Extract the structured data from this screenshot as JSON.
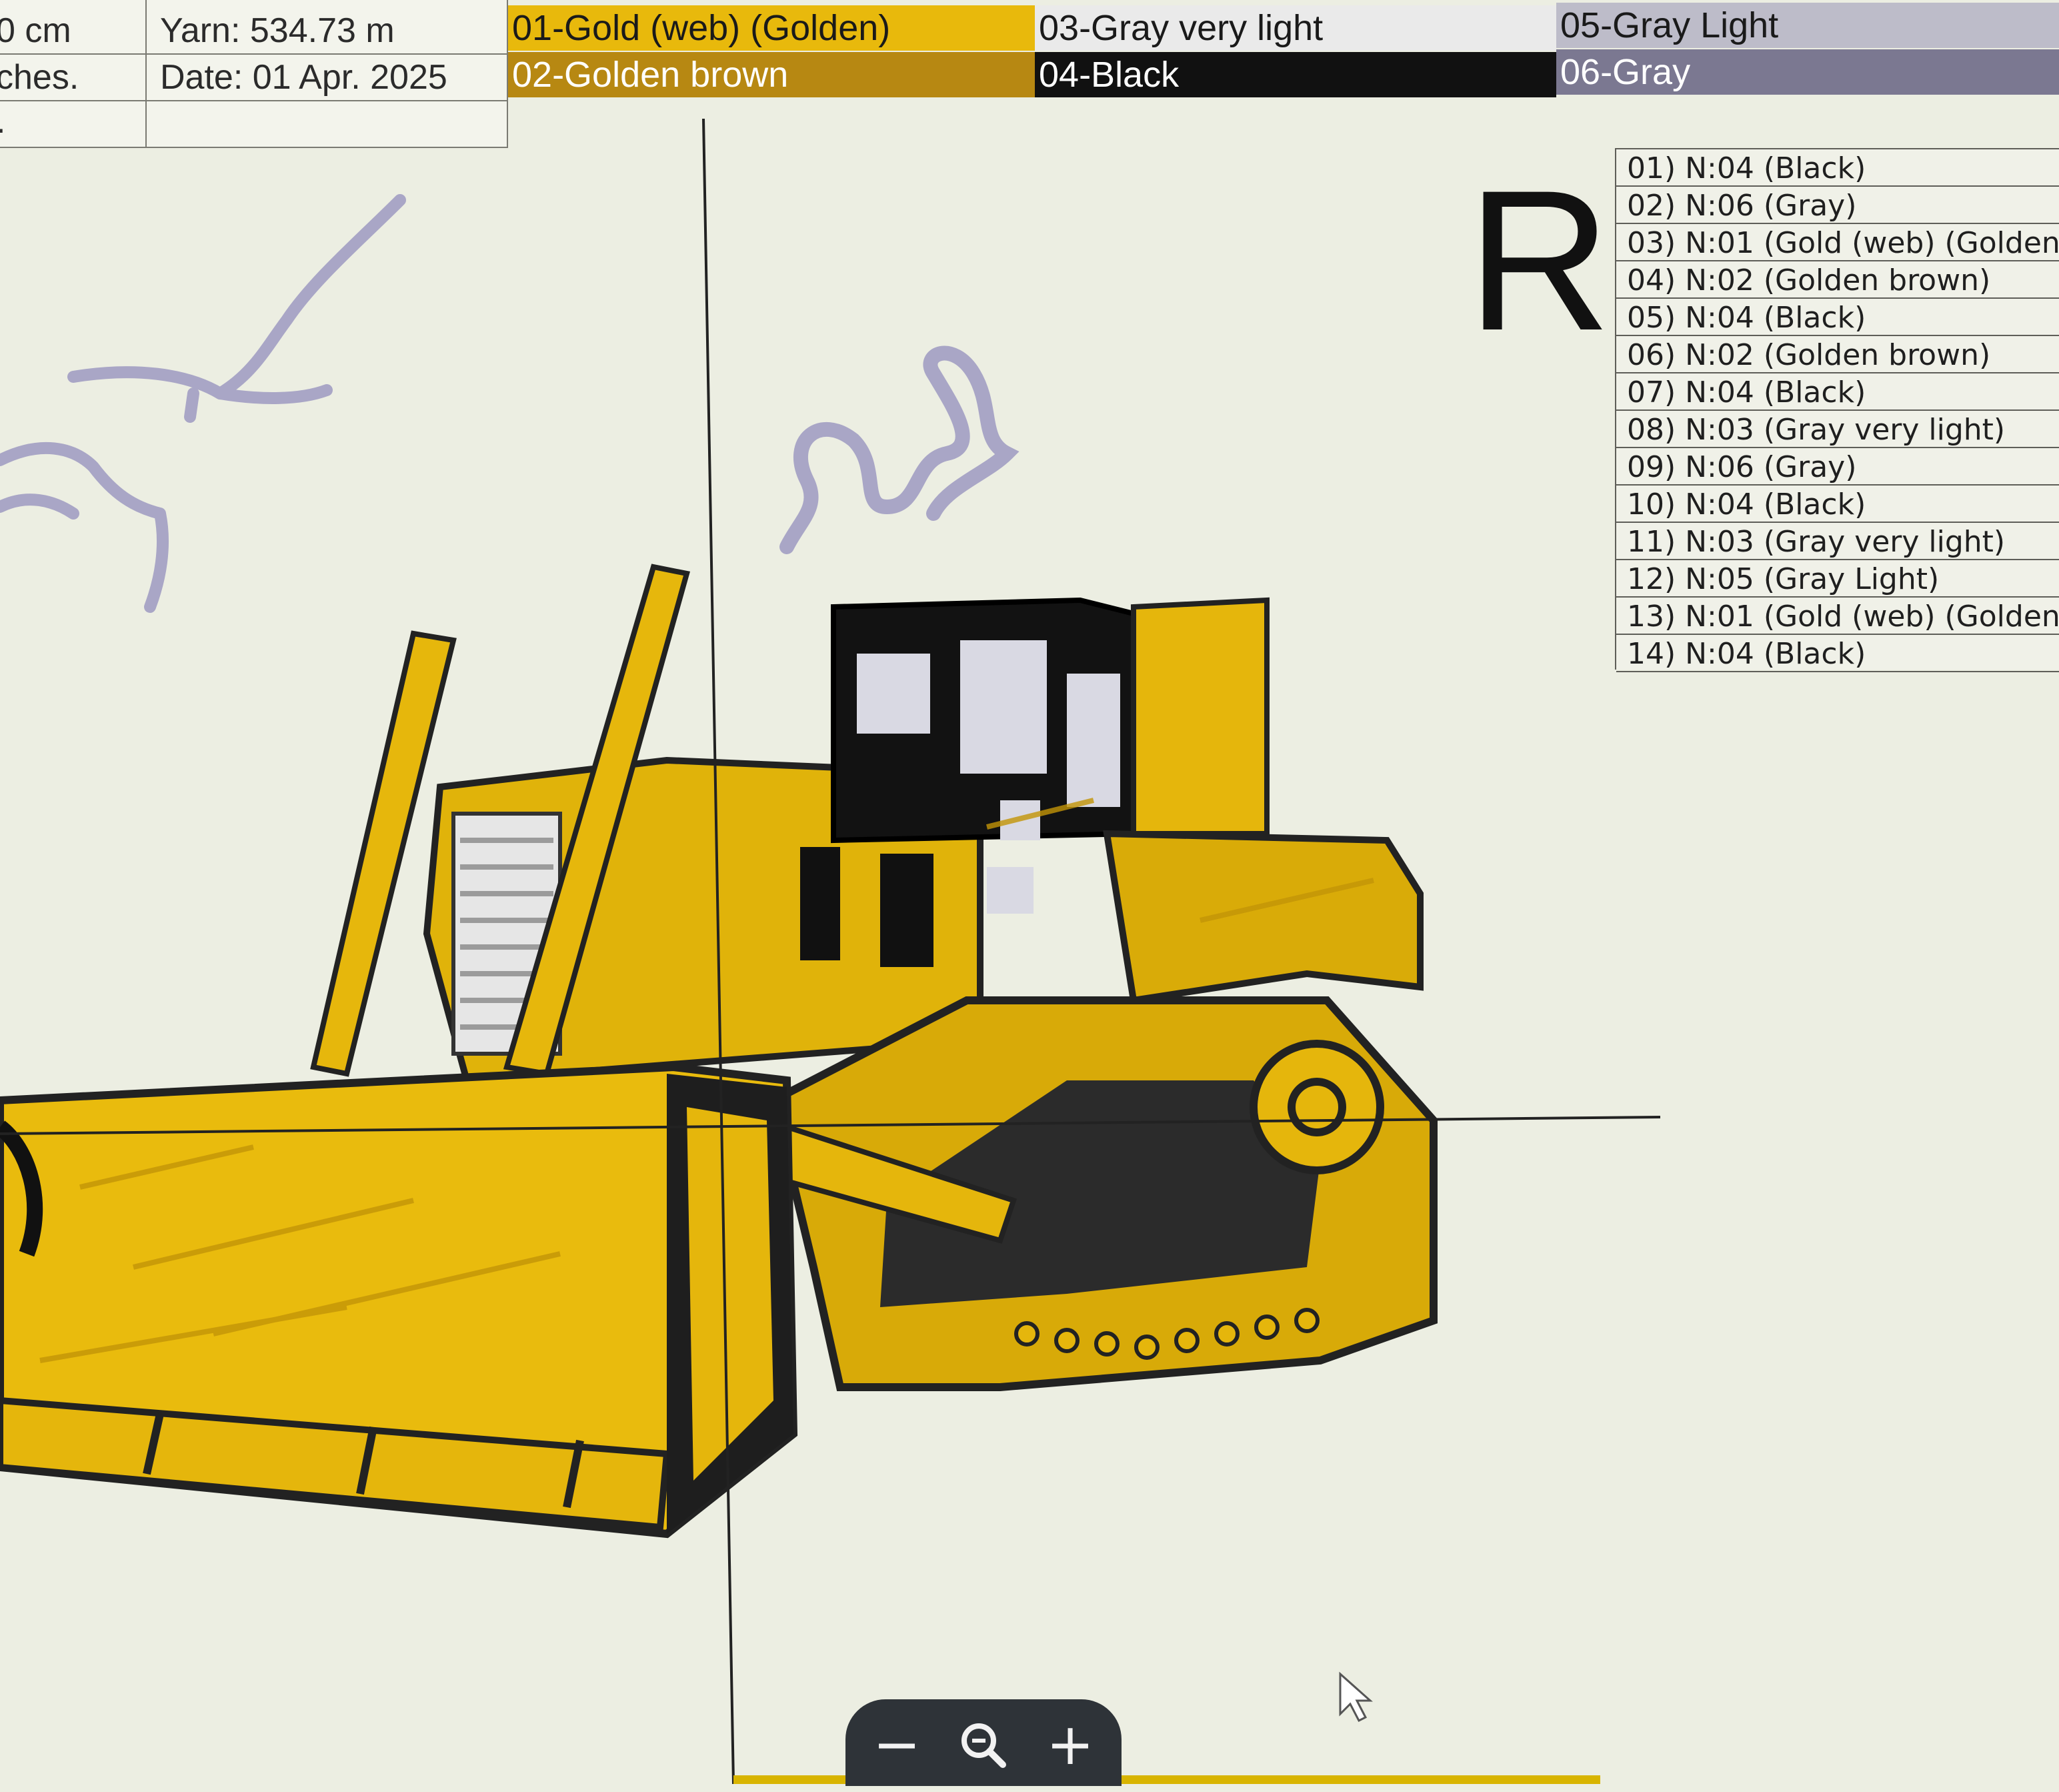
{
  "info_table": {
    "left_col": [
      "0 cm",
      "ches.",
      "."
    ],
    "yarn": "Yarn: 534.73 m",
    "date": "Date: 01 Apr. 2025"
  },
  "color_palette": [
    {
      "label": "01-Gold (web) (Golden)",
      "color": "#e8b90c",
      "text_color": "#1a1a1a"
    },
    {
      "label": "02-Golden brown",
      "color": "#b78812",
      "text_color": "#ffffff"
    },
    {
      "label": "03-Gray very light",
      "color": "#eaeaea",
      "text_color": "#1a1a1a"
    },
    {
      "label": "04-Black",
      "color": "#111111",
      "text_color": "#ffffff"
    },
    {
      "label": "05-Gray Light",
      "color": "#bdbcc9",
      "text_color": "#1a1a1a"
    },
    {
      "label": "06-Gray",
      "color": "#7b7891",
      "text_color": "#ffffff"
    }
  ],
  "stitch_sequence": [
    "01) N:04 (Black)",
    "02) N:06 (Gray)",
    "03) N:01 (Gold (web) (Golden)",
    "04) N:02 (Golden brown)",
    "05) N:04 (Black)",
    "06) N:02 (Golden brown)",
    "07) N:04 (Black)",
    "08) N:03 (Gray very light)",
    "09) N:06 (Gray)",
    "10) N:04 (Black)",
    "11) N:03 (Gray very light)",
    "12) N:05 (Gray Light)",
    "13) N:01 (Gold (web) (Golden)",
    "14) N:04 (Black)"
  ],
  "orientation_mark": "R",
  "zoom_controls": {
    "minus": "−",
    "magnifier": "magnifier-icon",
    "plus": "+"
  },
  "colors": {
    "canvas_bg": "#eceee2",
    "gold": "#e8b90c",
    "golden_brown": "#b78812",
    "black": "#111111",
    "gray_light": "#bdbcc9",
    "gray": "#7b7891"
  }
}
